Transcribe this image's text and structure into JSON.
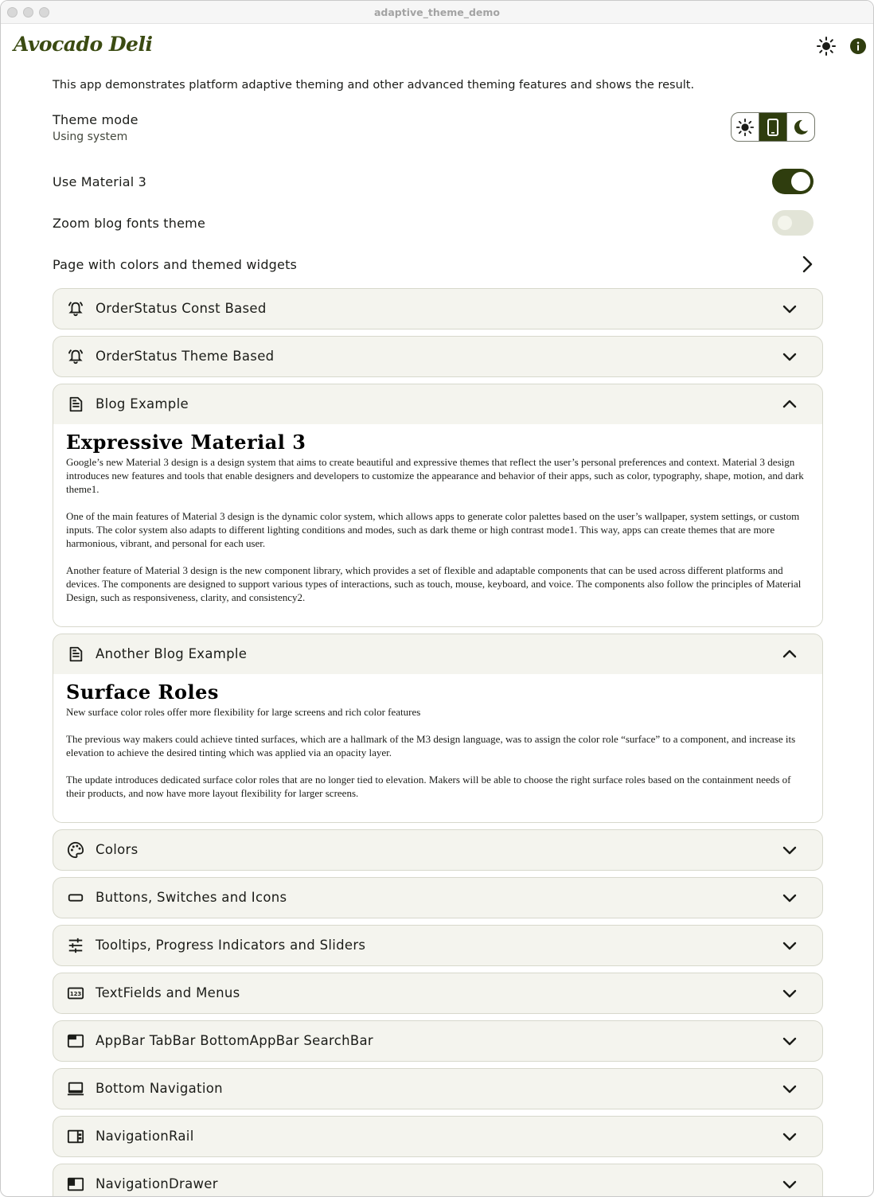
{
  "window": {
    "title": "adaptive_theme_demo"
  },
  "appbar": {
    "logo": "Avocado Deli",
    "theme_icon": "sun-icon",
    "info_icon": "info-icon"
  },
  "intro": "This app demonstrates platform adaptive theming and other advanced theming features and shows the result.",
  "theme_mode": {
    "label": "Theme mode",
    "sub": "Using system",
    "options": [
      "light",
      "system",
      "dark"
    ],
    "selected": "system"
  },
  "settings": {
    "use_m3": {
      "label": "Use Material 3",
      "on": true
    },
    "zoom_fonts": {
      "label": "Zoom blog fonts theme",
      "on": false
    },
    "colors_page": {
      "label": "Page with colors and themed widgets"
    }
  },
  "colors": {
    "primary": "#2f3d0e",
    "card_bg": "#f4f4ee",
    "card_border": "#d7d8cc",
    "on_surface": "#1b1c18"
  },
  "panels": [
    {
      "title": "OrderStatus Const Based",
      "icon": "alarm-bell-icon",
      "expanded": false
    },
    {
      "title": "OrderStatus Theme Based",
      "icon": "alarm-bell-icon",
      "expanded": false
    },
    {
      "title": "Blog Example",
      "icon": "article-icon",
      "expanded": true,
      "heading": "Expressive Material 3",
      "paragraphs": [
        "Google’s new Material 3 design is a design system that aims to create beautiful and expressive themes that reflect the user’s personal preferences and context. Material 3 design introduces new features and tools that enable designers and developers to customize the appearance and behavior of their apps, such as color, typography, shape, motion, and dark theme1.",
        "One of the main features of Material 3 design is the dynamic color system, which allows apps to generate color palettes based on the user’s wallpaper, system settings, or custom inputs. The color system also adapts to different lighting conditions and modes, such as dark theme or high contrast mode1. This way, apps can create themes that are more harmonious, vibrant, and personal for each user.",
        "Another feature of Material 3 design is the new component library, which provides a set of flexible and adaptable components that can be used across different platforms and devices. The components are designed to support various types of interactions, such as touch, mouse, keyboard, and voice. The components also follow the principles of Material Design, such as responsiveness, clarity, and consistency2."
      ]
    },
    {
      "title": "Another Blog Example",
      "icon": "article-icon",
      "expanded": true,
      "heading": "Surface Roles",
      "paragraphs": [
        "New surface color roles offer more flexibility for large screens and rich color features",
        "The previous way makers could achieve tinted surfaces, which are a hallmark of the M3 design language, was to assign the color role “surface” to a component, and increase its elevation to achieve the desired tinting which was applied via an opacity layer.",
        "The update introduces dedicated surface color roles that are no longer tied to elevation. Makers will be able to choose the right surface roles based on the containment needs of their products, and now have more layout flexibility for larger screens."
      ]
    },
    {
      "title": "Colors",
      "icon": "palette-icon",
      "expanded": false
    },
    {
      "title": "Buttons, Switches and Icons",
      "icon": "button-icon",
      "expanded": false
    },
    {
      "title": "Tooltips, Progress Indicators and Sliders",
      "icon": "tune-icon",
      "expanded": false
    },
    {
      "title": "TextFields and Menus",
      "icon": "pin-123-icon",
      "expanded": false
    },
    {
      "title": "AppBar TabBar BottomAppBar SearchBar",
      "icon": "web-asset-icon",
      "expanded": false
    },
    {
      "title": "Bottom Navigation",
      "icon": "laptop-icon",
      "expanded": false
    },
    {
      "title": "NavigationRail",
      "icon": "view-sidebar-icon",
      "expanded": false
    },
    {
      "title": "NavigationDrawer",
      "icon": "drawer-icon",
      "expanded": false
    }
  ]
}
